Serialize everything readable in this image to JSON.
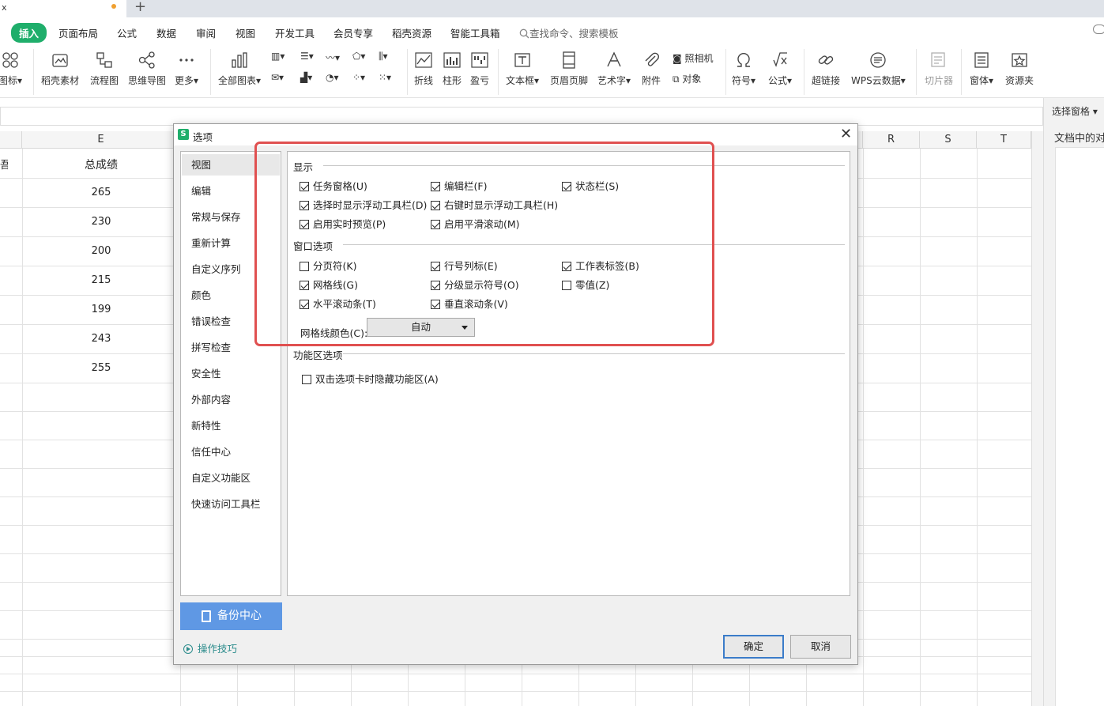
{
  "tab": {
    "title": "x"
  },
  "menu": {
    "items": [
      "插入",
      "页面布局",
      "公式",
      "数据",
      "审阅",
      "视图",
      "开发工具",
      "会员专享",
      "稻壳资源",
      "智能工具箱"
    ],
    "search_placeholder": "查找命令、搜索模板"
  },
  "ribbon": {
    "buttons": [
      "图标",
      "稻壳素材",
      "流程图",
      "思维导图",
      "更多",
      "全部图表",
      "折线",
      "柱形",
      "盈亏",
      "文本框",
      "页眉页脚",
      "艺术字",
      "附件",
      "符号",
      "公式",
      "超链接",
      "WPS云数据",
      "切片器",
      "窗体",
      "资源夹"
    ],
    "camera": "照相机",
    "object": "对象"
  },
  "sheet": {
    "col_heads": [
      "E",
      "R",
      "S",
      "T"
    ],
    "partial_header": "吾",
    "header": "总成绩",
    "scores": [
      "265",
      "230",
      "200",
      "215",
      "199",
      "243",
      "255"
    ]
  },
  "side_pane": {
    "title": "选择窗格",
    "subtitle": "文档中的对"
  },
  "dialog": {
    "title": "选项",
    "nav": [
      "视图",
      "编辑",
      "常规与保存",
      "重新计算",
      "自定义序列",
      "颜色",
      "错误检查",
      "拼写检查",
      "安全性",
      "外部内容",
      "新特性",
      "信任中心",
      "自定义功能区",
      "快速访问工具栏"
    ],
    "backup": "备份中心",
    "tips": "操作技巧",
    "sections": {
      "display": "显示",
      "window": "窗口选项",
      "ribbon": "功能区选项"
    },
    "display_options": [
      {
        "label": "任务窗格(U)",
        "checked": true
      },
      {
        "label": "编辑栏(F)",
        "checked": true
      },
      {
        "label": "状态栏(S)",
        "checked": true
      },
      {
        "label": "选择时显示浮动工具栏(D)",
        "checked": true
      },
      {
        "label": "右键时显示浮动工具栏(H)",
        "checked": true
      },
      {
        "label": "启用实时预览(P)",
        "checked": true
      },
      {
        "label": "启用平滑滚动(M)",
        "checked": true
      }
    ],
    "window_options": [
      {
        "label": "分页符(K)",
        "checked": false
      },
      {
        "label": "行号列标(E)",
        "checked": true
      },
      {
        "label": "工作表标签(B)",
        "checked": true
      },
      {
        "label": "网格线(G)",
        "checked": true
      },
      {
        "label": "分级显示符号(O)",
        "checked": true
      },
      {
        "label": "零值(Z)",
        "checked": false
      },
      {
        "label": "水平滚动条(T)",
        "checked": true
      },
      {
        "label": "垂直滚动条(V)",
        "checked": true
      }
    ],
    "grid_color_label": "网格线颜色(C):",
    "grid_color_value": "自动",
    "ribbon_options": [
      {
        "label": "双击选项卡时隐藏功能区(A)",
        "checked": false
      }
    ],
    "ok": "确定",
    "cancel": "取消"
  },
  "colors": {
    "accent_green": "#1fae6b",
    "backup_blue": "#5f98e4",
    "highlight_red": "#e05050"
  }
}
